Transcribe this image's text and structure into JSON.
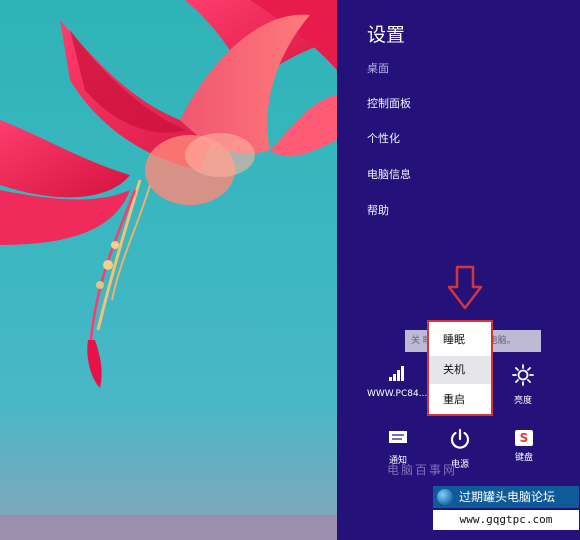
{
  "charms": {
    "title": "设置",
    "items": [
      {
        "label": "桌面",
        "active": false
      },
      {
        "label": "控制面板",
        "active": true
      },
      {
        "label": "个性化",
        "active": true
      },
      {
        "label": "电脑信息",
        "active": true
      },
      {
        "label": "帮助",
        "active": true
      }
    ],
    "tooltip_text": "关 睡眠 ，然后关闭电脑。",
    "power_menu": {
      "options": [
        {
          "label": "睡眠",
          "highlighted": false
        },
        {
          "label": "关机",
          "highlighted": true
        },
        {
          "label": "重启",
          "highlighted": false
        }
      ]
    },
    "quick_settings": {
      "network_label": "WWW.PC84...",
      "brightness_label": "亮度"
    },
    "bottom_icons": {
      "notifications_label": "通知",
      "power_label": "电源",
      "keyboard_label": "键盘"
    }
  },
  "watermark": {
    "faint_text": "电脑百事网",
    "title": "过期罐头电脑论坛",
    "url": "www.gqgtpc.com"
  },
  "colors": {
    "charm_bg": "#24127a",
    "highlight_border": "#d3363a",
    "wallpaper": "#2fb3b7"
  }
}
